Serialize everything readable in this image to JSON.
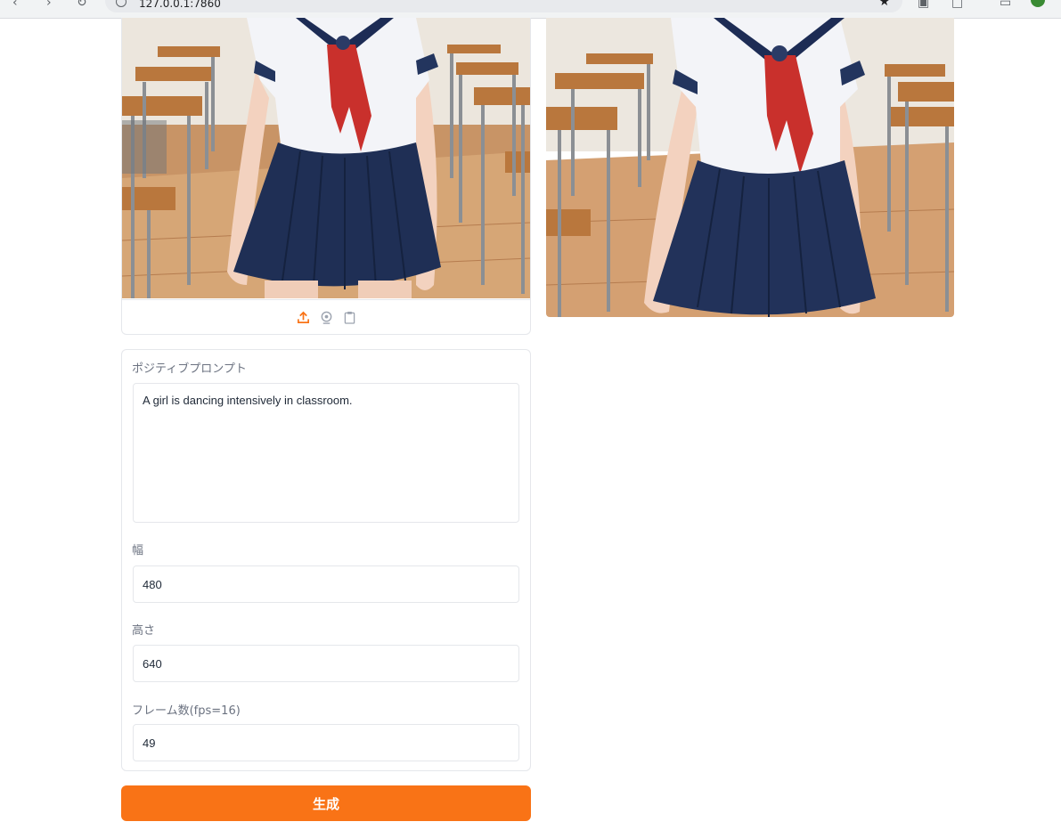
{
  "browser": {
    "url": "127.0.0.1:7860",
    "accent_avatar_color": "#3a8b33"
  },
  "input_image": {
    "alt": "classroom sailor uniform input",
    "tools": [
      "upload-icon",
      "webcam-icon",
      "clipboard-icon"
    ]
  },
  "output_image": {
    "alt": "generated frame"
  },
  "form": {
    "prompt_label": "ポジティブプロンプト",
    "prompt_value": "A girl is dancing intensively in classroom.",
    "width_label": "幅",
    "width_value": "480",
    "height_label": "高さ",
    "height_value": "640",
    "frames_label": "フレーム数(fps=16)",
    "frames_value": "49"
  },
  "actions": {
    "generate_label": "生成"
  },
  "colors": {
    "accent": "#f97316",
    "border": "#e5e7eb"
  }
}
